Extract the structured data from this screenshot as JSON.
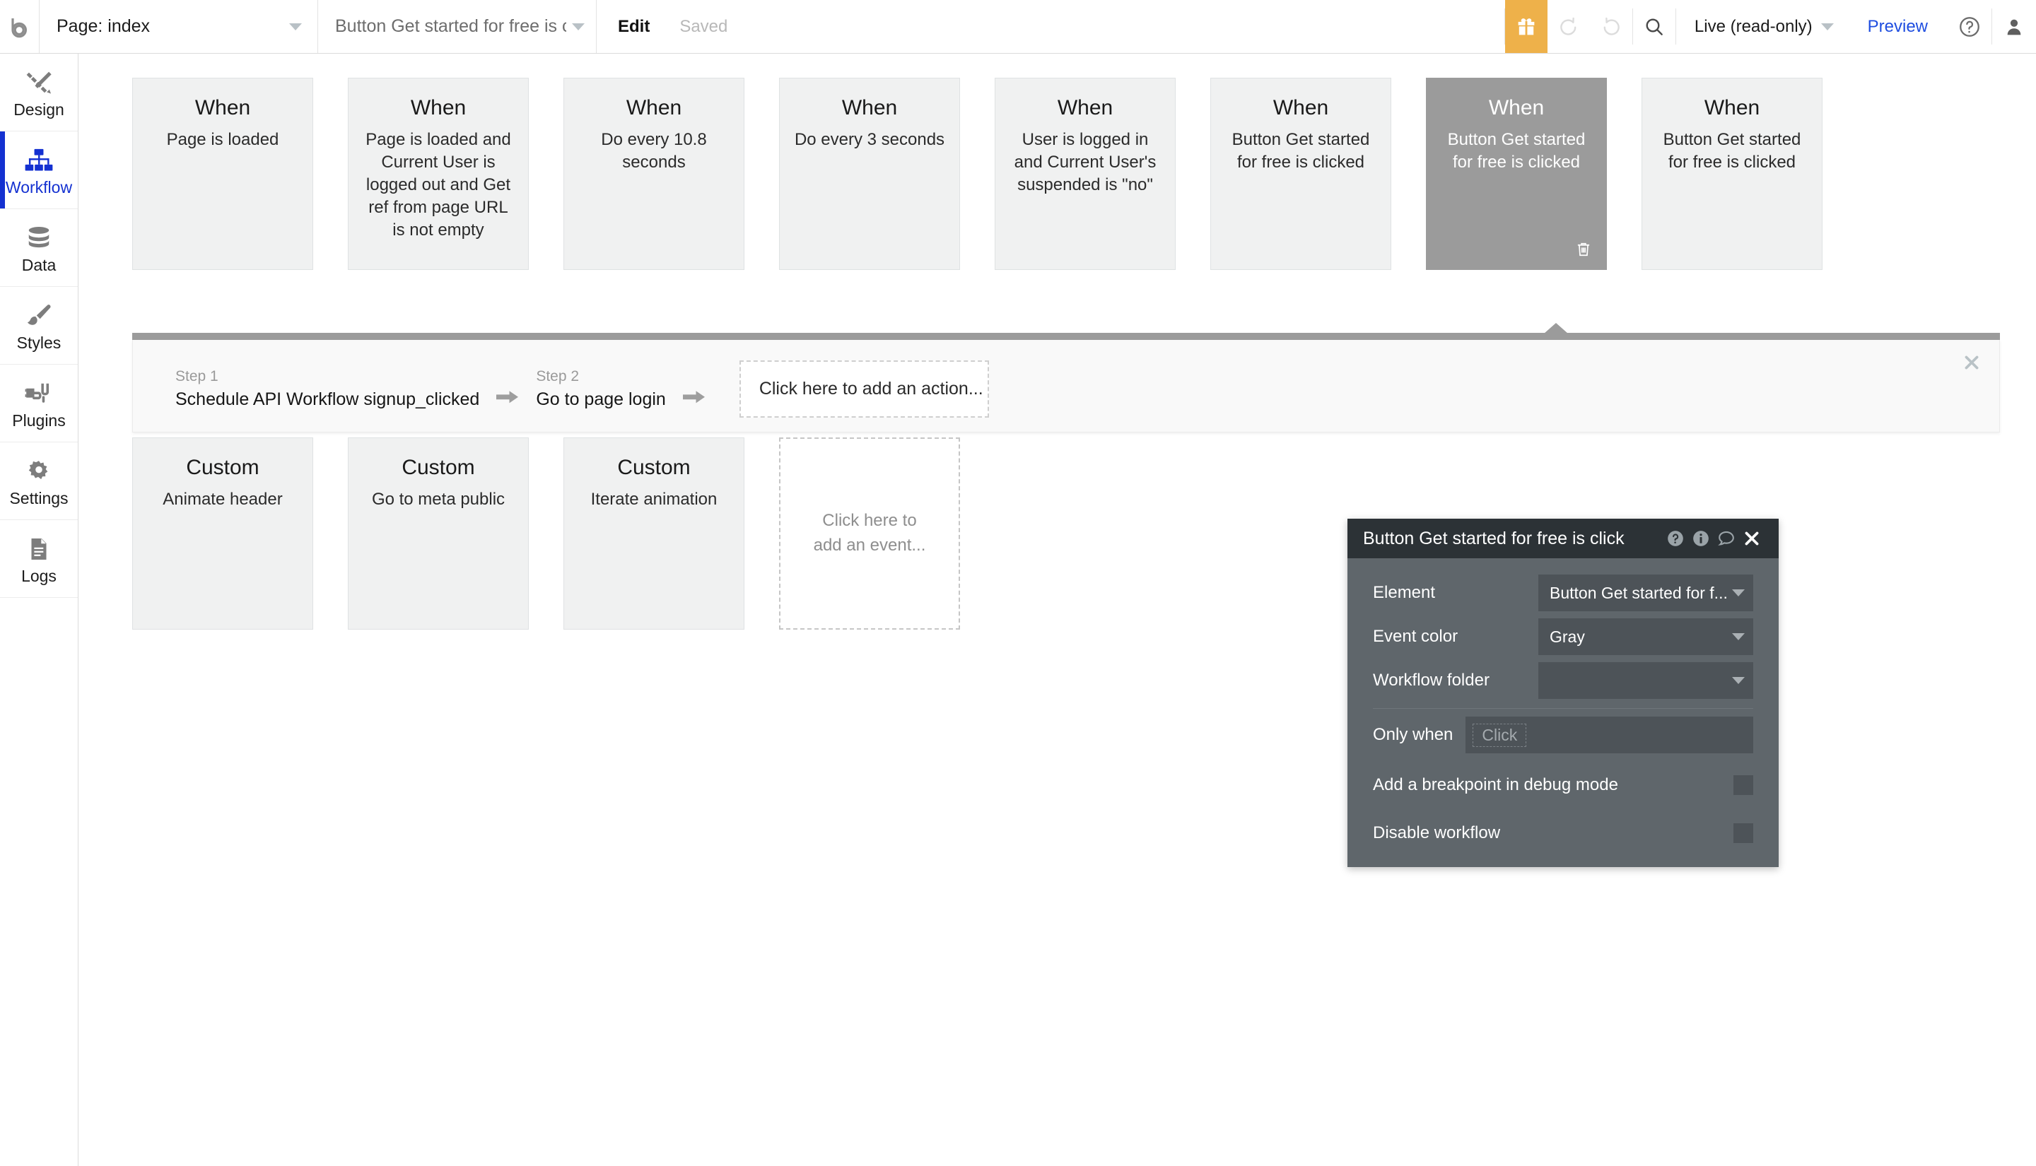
{
  "topbar": {
    "logo_icon": "bubble-logo-icon",
    "page_selector": {
      "label": "Page: index",
      "caret_icon": "chevron-down-icon"
    },
    "workflow_selector": {
      "label": "Button Get started for free is clic...",
      "caret_icon": "chevron-down-icon"
    },
    "edit_label": "Edit",
    "saved_label": "Saved",
    "gift_icon": "gift-icon",
    "undo_icon": "undo-icon",
    "redo_icon": "redo-icon",
    "search_icon": "search-icon",
    "mode_label": "Live (read-only)",
    "mode_caret_icon": "chevron-down-icon",
    "preview_label": "Preview",
    "help_icon": "question-circle-icon",
    "avatar_icon": "user-avatar-icon",
    "accent_color": "#eeb14a",
    "link_color": "#1f4ee0"
  },
  "sidebar": {
    "items": [
      {
        "label": "Design",
        "icon": "design-pencil-ruler-icon",
        "active": false
      },
      {
        "label": "Workflow",
        "icon": "workflow-tree-icon",
        "active": true
      },
      {
        "label": "Data",
        "icon": "database-icon",
        "active": false
      },
      {
        "label": "Styles",
        "icon": "paintbrush-icon",
        "active": false
      },
      {
        "label": "Plugins",
        "icon": "plug-icon",
        "active": false
      },
      {
        "label": "Settings",
        "icon": "gear-icon",
        "active": false
      },
      {
        "label": "Logs",
        "icon": "document-lines-icon",
        "active": false
      }
    ],
    "collapse_icon": "triangle-right-icon",
    "active_color": "#1431d1"
  },
  "canvas": {
    "events_row1": [
      {
        "type": "When",
        "desc": "Page is loaded",
        "selected": false
      },
      {
        "type": "When",
        "desc": "Page is loaded and Current User is logged out and Get ref from page URL is not empty",
        "selected": false
      },
      {
        "type": "When",
        "desc": "Do every 10.8 seconds",
        "selected": false
      },
      {
        "type": "When",
        "desc": "Do every 3 seconds",
        "selected": false
      },
      {
        "type": "When",
        "desc": "User is logged in and Current User's suspended is \"no\"",
        "selected": false
      },
      {
        "type": "When",
        "desc": "Button Get started for free is clicked",
        "selected": false
      },
      {
        "type": "When",
        "desc": "Button Get started for free is clicked",
        "selected": true,
        "trash_icon": "trash-icon"
      },
      {
        "type": "When",
        "desc": "Button Get started for free is clicked",
        "selected": false
      }
    ],
    "events_row2": [
      {
        "type": "Custom",
        "desc": "Animate header",
        "selected": false
      },
      {
        "type": "Custom",
        "desc": "Go to meta public",
        "selected": false
      },
      {
        "type": "Custom",
        "desc": "Iterate animation",
        "selected": false
      }
    ],
    "add_event_placeholder": "Click here to add an event...",
    "selected_card_color": "#9b9b9b",
    "card_color": "#f0f1f1"
  },
  "steps_panel": {
    "close_icon": "close-x-icon",
    "arrow_icon": "arrow-right-icon",
    "steps": [
      {
        "number": "Step 1",
        "label": "Schedule API Workflow signup_clicked"
      },
      {
        "number": "Step 2",
        "label": "Go to page login"
      }
    ],
    "add_action_label": "Click here to add an action..."
  },
  "property_panel": {
    "title": "Button Get started for free is click",
    "header_icons": [
      {
        "name": "help-circle-icon"
      },
      {
        "name": "info-circle-icon"
      },
      {
        "name": "comment-bubble-icon"
      },
      {
        "name": "close-x-icon"
      }
    ],
    "fields": [
      {
        "label": "Element",
        "value": "Button Get started for f...",
        "caret_icon": "chevron-down-icon"
      },
      {
        "label": "Event color",
        "value": "Gray",
        "caret_icon": "chevron-down-icon"
      },
      {
        "label": "Workflow folder",
        "value": "",
        "caret_icon": "chevron-down-icon"
      }
    ],
    "only_when": {
      "label": "Only when",
      "placeholder": "Click"
    },
    "checkboxes": [
      {
        "label": "Add a breakpoint in debug mode",
        "checked": false
      },
      {
        "label": "Disable workflow",
        "checked": false
      }
    ],
    "header_color": "#2c3236",
    "body_color": "#5f666b"
  }
}
